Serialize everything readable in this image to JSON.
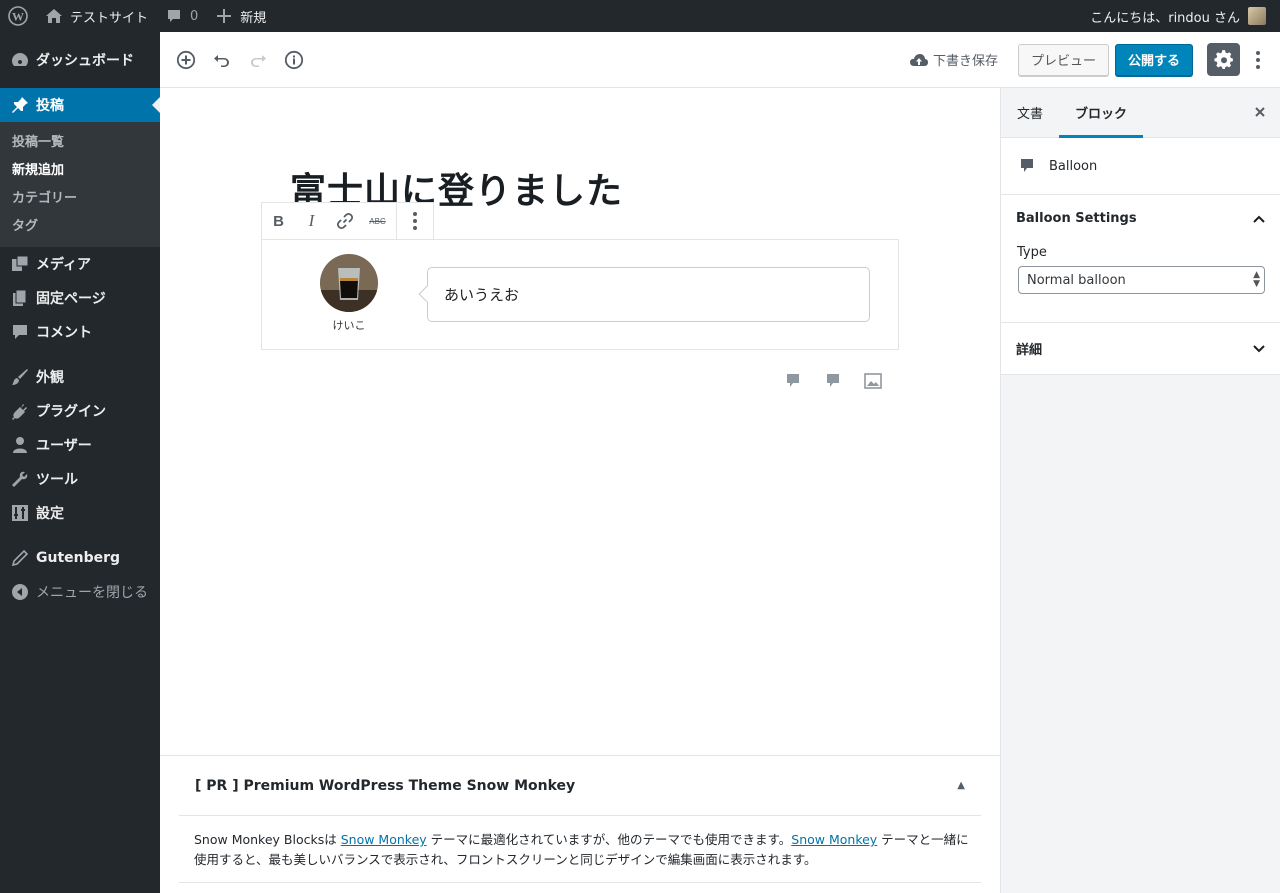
{
  "adminbar": {
    "site_name": "テストサイト",
    "comments_count": "0",
    "new_label": "新規",
    "greeting": "こんにちは、rindou さん"
  },
  "menu": {
    "dashboard": "ダッシュボード",
    "posts": "投稿",
    "posts_sub": [
      "投稿一覧",
      "新規追加",
      "カテゴリー",
      "タグ"
    ],
    "media": "メディア",
    "pages": "固定ページ",
    "comments": "コメント",
    "appearance": "外観",
    "plugins": "プラグイン",
    "users": "ユーザー",
    "tools": "ツール",
    "settings": "設定",
    "gutenberg": "Gutenberg",
    "collapse": "メニューを閉じる"
  },
  "header": {
    "save_draft": "下書き保存",
    "preview": "プレビュー",
    "publish": "公開する"
  },
  "editor": {
    "post_title": "富士山に登りました",
    "balloon_name": "けいこ",
    "balloon_text": "あいうえお"
  },
  "metabox": {
    "title": "[ PR ] Premium WordPress Theme Snow Monkey",
    "text_1": "Snow Monkey Blocksは ",
    "link_1": "Snow Monkey",
    "text_2": " テーマに最適化されていますが、他のテーマでも使用できます。",
    "link_2": "Snow Monkey",
    "text_3": " テーマと一緒に使用すると、最も美しいバランスで表示され、フロントスクリーンと同じデザインで編集画面に表示されます。"
  },
  "sidebar": {
    "tab_document": "文書",
    "tab_block": "ブロック",
    "block_name": "Balloon",
    "panel_settings": "Balloon Settings",
    "type_label": "Type",
    "type_value": "Normal balloon",
    "panel_detail": "詳細"
  },
  "colors": {
    "admin_dark": "#23282d",
    "accent": "#0073aa",
    "publish": "#0085ba"
  }
}
